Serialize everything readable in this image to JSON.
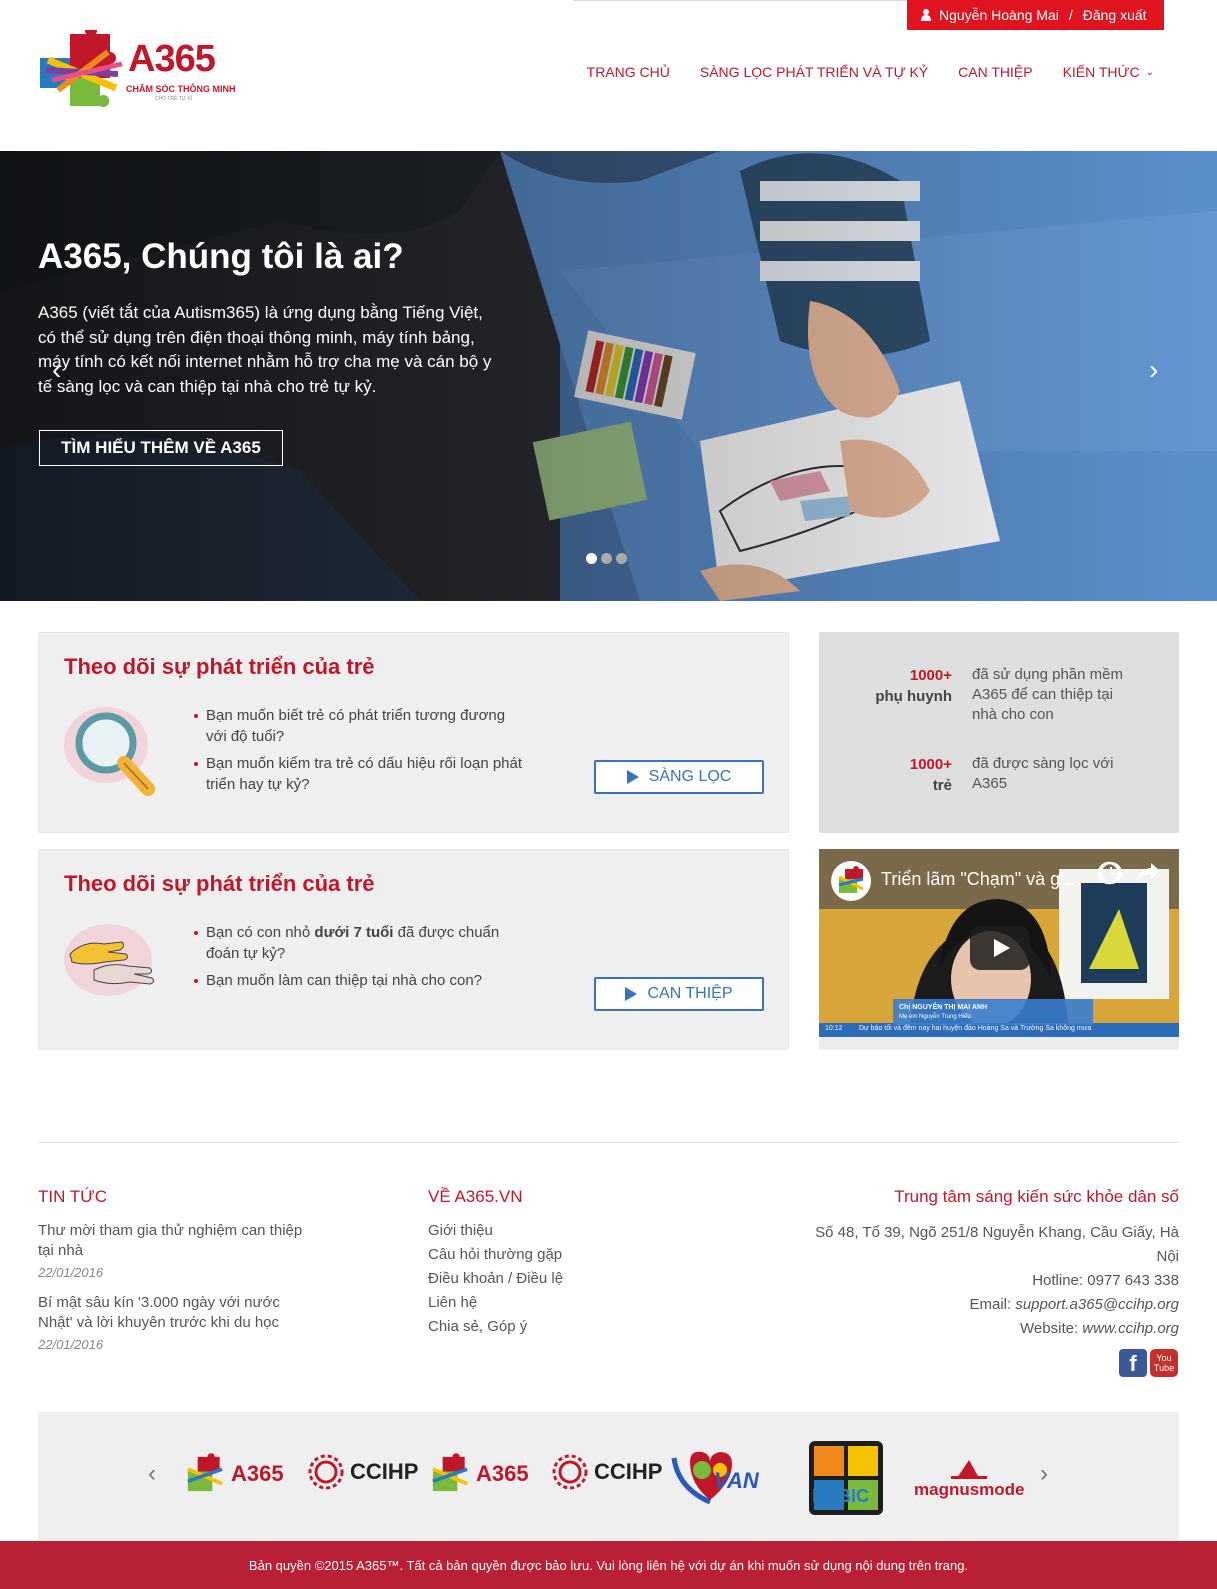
{
  "header": {
    "user_name": "Nguyễn Hoàng Mai",
    "separator": "/",
    "logout": "Đăng xuất",
    "logo_text": "A365",
    "logo_tagline": "CHĂM SÓC THÔNG MINH",
    "logo_tagline_small": "CHO TRẺ TỰ KỈ",
    "nav": [
      "TRANG CHỦ",
      "SÀNG LỌC PHÁT TRIỂN VÀ TỰ KỶ",
      "CAN THIỆP",
      "KIẾN THỨC"
    ]
  },
  "hero": {
    "title": "A365, Chúng tôi là ai?",
    "text": "A365 (viết tắt của Autism365) là ứng dụng bằng Tiếng Việt, có thể sử dụng trên điện thoại thông minh, máy tính bảng, máy tính có kết nối internet nhằm hỗ trợ cha mẹ và cán bộ y tế sàng lọc và can thiệp tại nhà cho trẻ tự kỷ.",
    "button": "TÌM HIỂU THÊM VỀ A365",
    "prev_arrow": "‹",
    "next_arrow": "›"
  },
  "cards": [
    {
      "title": "Theo dõi sự phát triển của trẻ",
      "bullets": [
        "Bạn muốn biết trẻ có phát triển tương đương với độ tuổi?",
        "Bạn muốn kiểm tra trẻ có dấu hiệu rối loạn phát triển hay tự kỷ?"
      ],
      "button": "SÀNG LỌC"
    },
    {
      "title": "Theo dõi sự phát triển của trẻ",
      "bullet1_pre": "Bạn có con nhỏ ",
      "bullet1_bold": "dưới 7 tuổi",
      "bullet1_post": " đã được chuẩn đoán tự kỷ?",
      "bullet2": "Bạn muốn làm can thiệp tại nhà cho con?",
      "button": "CAN THIỆP"
    }
  ],
  "stats": [
    {
      "number": "1000+",
      "unit": "phụ huynh",
      "desc": "đã sử dụng phần mềm A365 để can thiệp tại nhà cho con"
    },
    {
      "number": "1000+",
      "unit": "trẻ",
      "desc": "đã được sàng lọc với A365"
    }
  ],
  "video": {
    "title": "Triển lãm \"Chạm\" và giới thiệu",
    "caption_name": "Chị NGUYỄN THỊ MAI ANH",
    "caption_sub": "Mẹ em Nguyễn Trung Hiếu",
    "ticker": "Dự báo tối và đêm nay hai huyện đảo Hoàng Sa và Trường Sa không mưa",
    "time": "10:12"
  },
  "footer": {
    "news_title": "TIN TỨC",
    "news": [
      {
        "title": "Thư mời tham gia thử nghiệm can thiệp tại nhà",
        "date": "22/01/2016"
      },
      {
        "title": "Bí mật sâu kín '3.000 ngày với nước Nhật' và lời khuyên trước khi du học",
        "date": "22/01/2016"
      }
    ],
    "about_title": "VỀ A365.VN",
    "about_links": [
      "Giới thiệu",
      "Câu hỏi thường gặp",
      "Điều khoản / Điều lệ",
      "Liên hệ",
      "Chia sẻ, Góp ý"
    ],
    "center_title": "Trung tâm sáng kiến sức khỏe dân số",
    "address": "Số 48, Tổ 39, Ngõ 251/8 Nguyễn Khang, Cầu Giấy, Hà Nội",
    "hotline": "Hotline: 0977 643 338",
    "email_label": "Email: ",
    "email": "support.a365@ccihp.org",
    "website_label": "Website: ",
    "website": "www.ccihp.org",
    "facebook": "f",
    "youtube_1": "You",
    "youtube_2": "Tube"
  },
  "partners": {
    "logos": [
      "A365",
      "CCIHP",
      "A365",
      "CCIHP",
      "VAN",
      "RUBIC",
      "magnusmode"
    ]
  },
  "copyright": "Bản quyền ©2015 A365™. Tất cả bản quyền được bảo lưu. Vui lòng liên hệ với dự án khi muốn sử dụng nội dung trên trang.",
  "colors": {
    "brand_red": "#c0172b",
    "bar_red": "#e0141e",
    "link_blue": "#3a72b8"
  }
}
